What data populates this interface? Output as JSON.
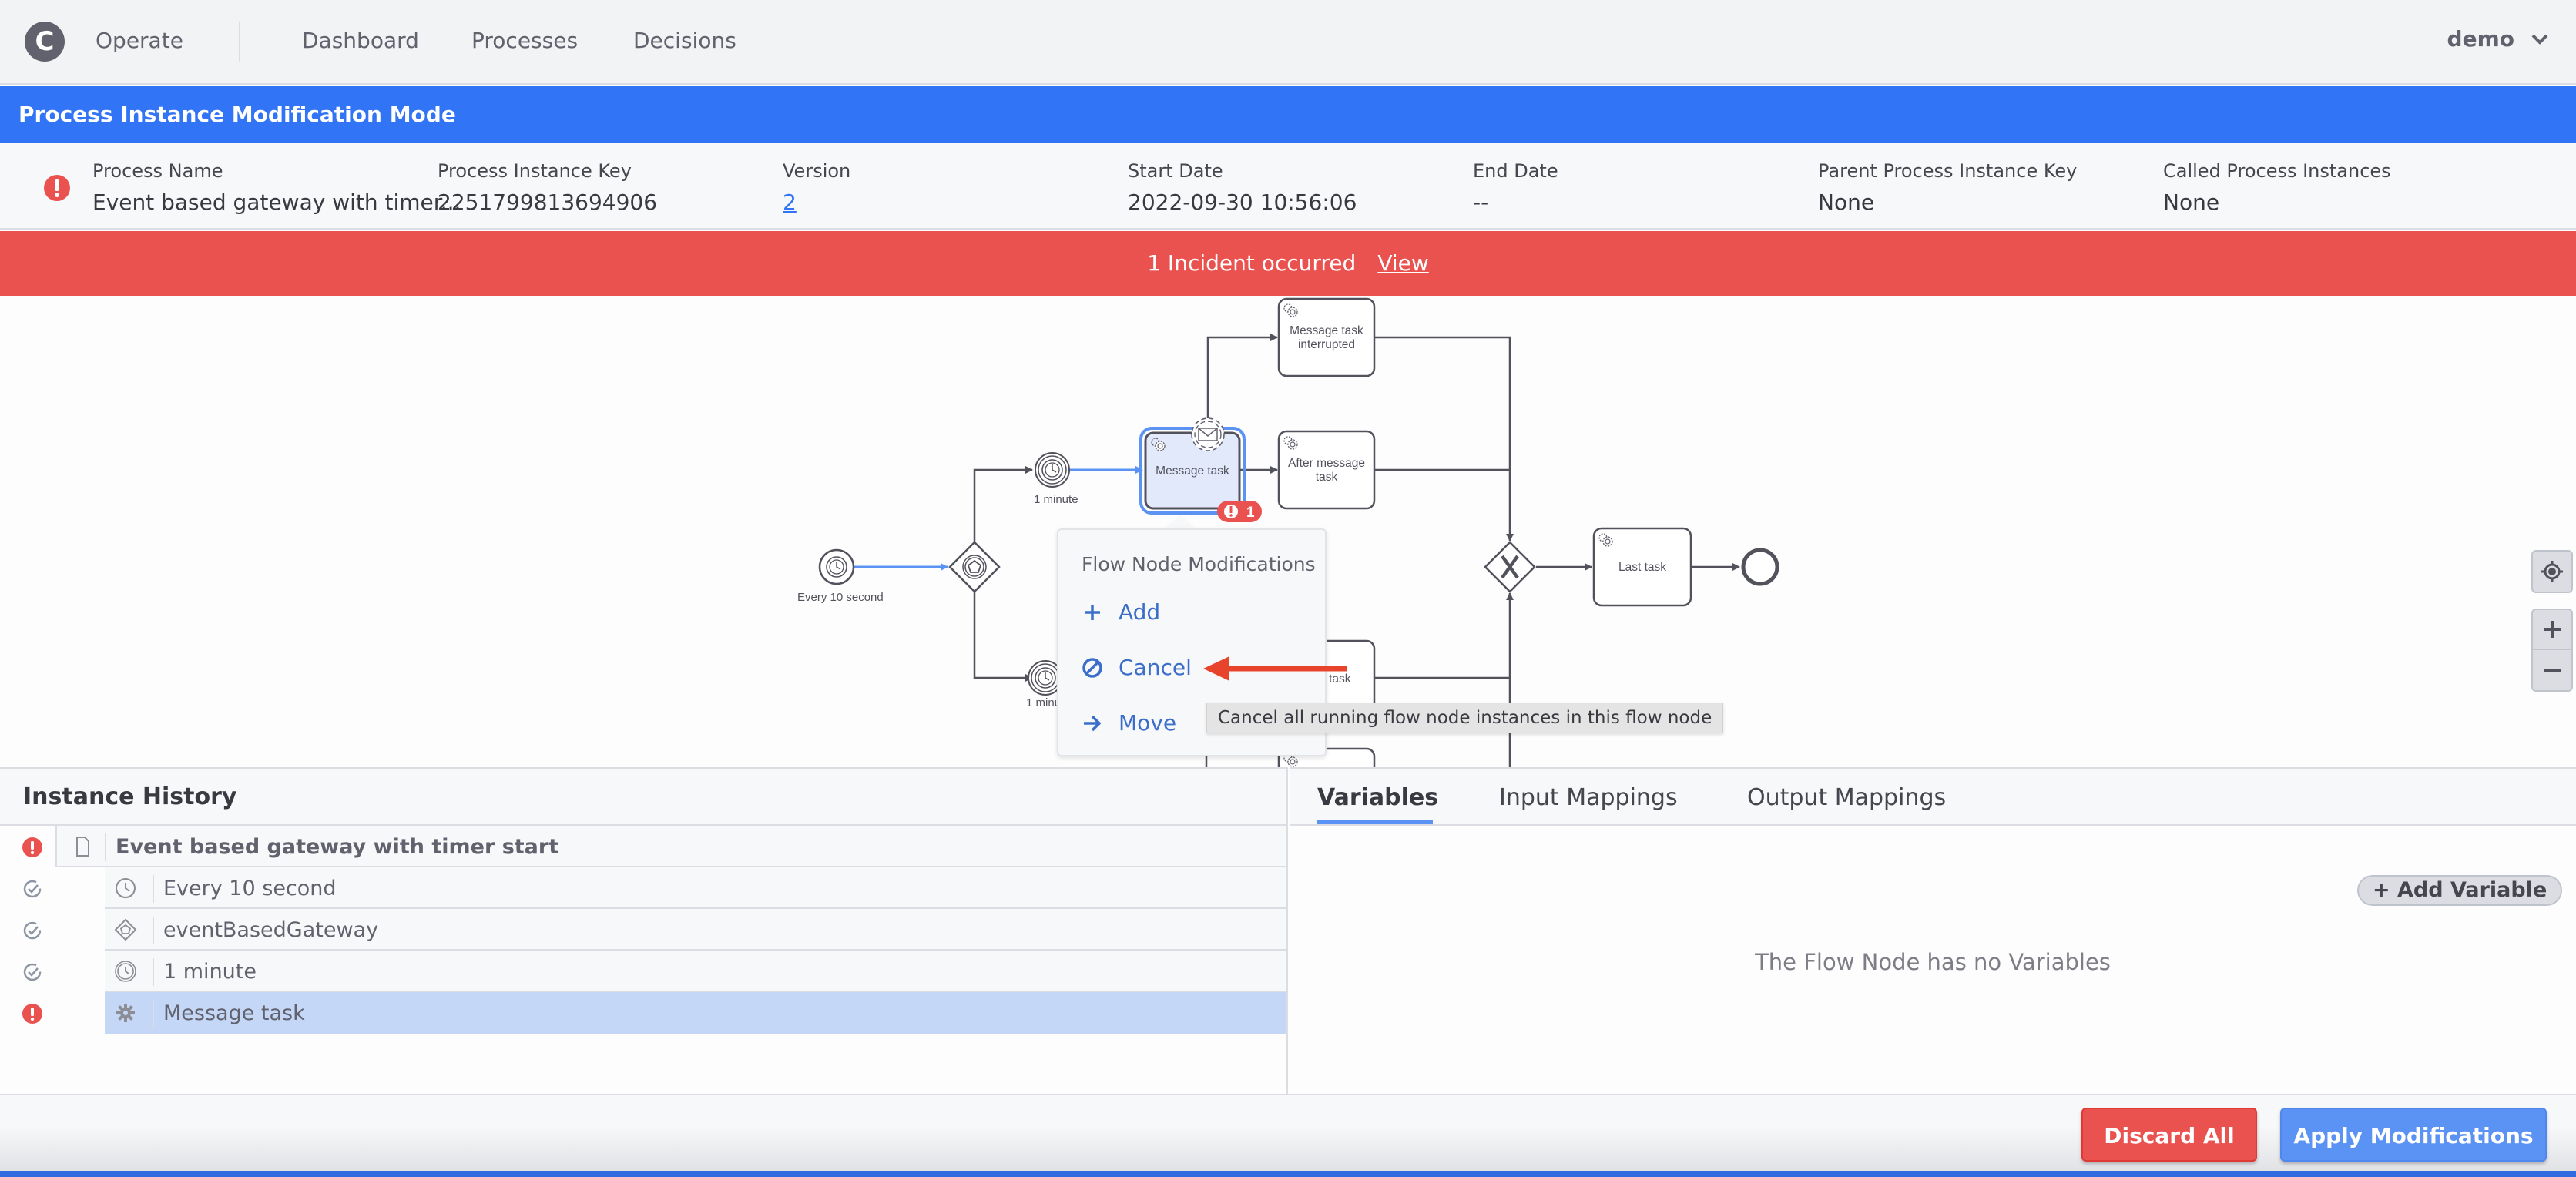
{
  "header": {
    "logo_letter": "C",
    "app_name": "Operate",
    "nav": [
      "Dashboard",
      "Processes",
      "Decisions"
    ],
    "user": "demo"
  },
  "mode_bar": {
    "title": "Process Instance Modification Mode",
    "color": "#3274f6"
  },
  "instance_info": {
    "status": "incident",
    "fields": [
      {
        "label": "Process Name",
        "value": "Event based gateway with timer..."
      },
      {
        "label": "Process Instance Key",
        "value": "2251799813694906"
      },
      {
        "label": "Version",
        "value": "2"
      },
      {
        "label": "Start Date",
        "value": "2022-09-30 10:56:06"
      },
      {
        "label": "End Date",
        "value": "--"
      },
      {
        "label": "Parent Process Instance Key",
        "value": "None"
      },
      {
        "label": "Called Process Instances",
        "value": "None"
      }
    ]
  },
  "incident_bar": {
    "text": "1 Incident occurred",
    "link": "View",
    "color": "#ea5250"
  },
  "diagram": {
    "nodes": {
      "start_timer": "Every 10 second",
      "gateway": "eventBasedGateway",
      "timer_1": "1 minute",
      "timer_2": "1 minu",
      "message_task": "Message task",
      "message_task_interrupted": [
        "Message task",
        "interrupted"
      ],
      "after_message_task": [
        "After message",
        "task"
      ],
      "hidden_task": "ner task",
      "last_task": "Last task"
    },
    "incident_badge": "1",
    "popover": {
      "title": "Flow Node Modifications",
      "items": [
        {
          "icon": "plus-icon",
          "label": "Add"
        },
        {
          "icon": "cancel-icon",
          "label": "Cancel"
        },
        {
          "icon": "arrow-right-icon",
          "label": "Move"
        }
      ]
    },
    "tooltip": "Cancel all running flow node instances in this flow node",
    "controls": {
      "reset": "reset-diagram-zoom",
      "zoom_in": "+",
      "zoom_out": "−"
    }
  },
  "instance_history": {
    "title": "Instance History",
    "rows": [
      {
        "status": "incident",
        "icon": "document-icon",
        "label": "Event based gateway with timer start",
        "level": 0
      },
      {
        "status": "completed",
        "icon": "timer-icon",
        "label": "Every 10 second",
        "level": 1
      },
      {
        "status": "completed",
        "icon": "event-gateway-icon",
        "label": "eventBasedGateway",
        "level": 1
      },
      {
        "status": "completed",
        "icon": "intermediate-timer-icon",
        "label": "1 minute",
        "level": 1
      },
      {
        "status": "incident",
        "icon": "service-task-icon",
        "label": "Message task",
        "level": 1,
        "selected": true
      }
    ]
  },
  "variables_panel": {
    "tabs": [
      {
        "label": "Variables",
        "active": true
      },
      {
        "label": "Input Mappings",
        "active": false
      },
      {
        "label": "Output Mappings",
        "active": false
      }
    ],
    "add_variable": "+ Add Variable",
    "empty_message": "The Flow Node has no Variables"
  },
  "footer": {
    "discard": "Discard All",
    "apply": "Apply Modifications"
  },
  "colors": {
    "primary": "#3274f6",
    "danger": "#ea5250",
    "selected_row": "#c4d7f7",
    "link": "#3b6ec9"
  }
}
